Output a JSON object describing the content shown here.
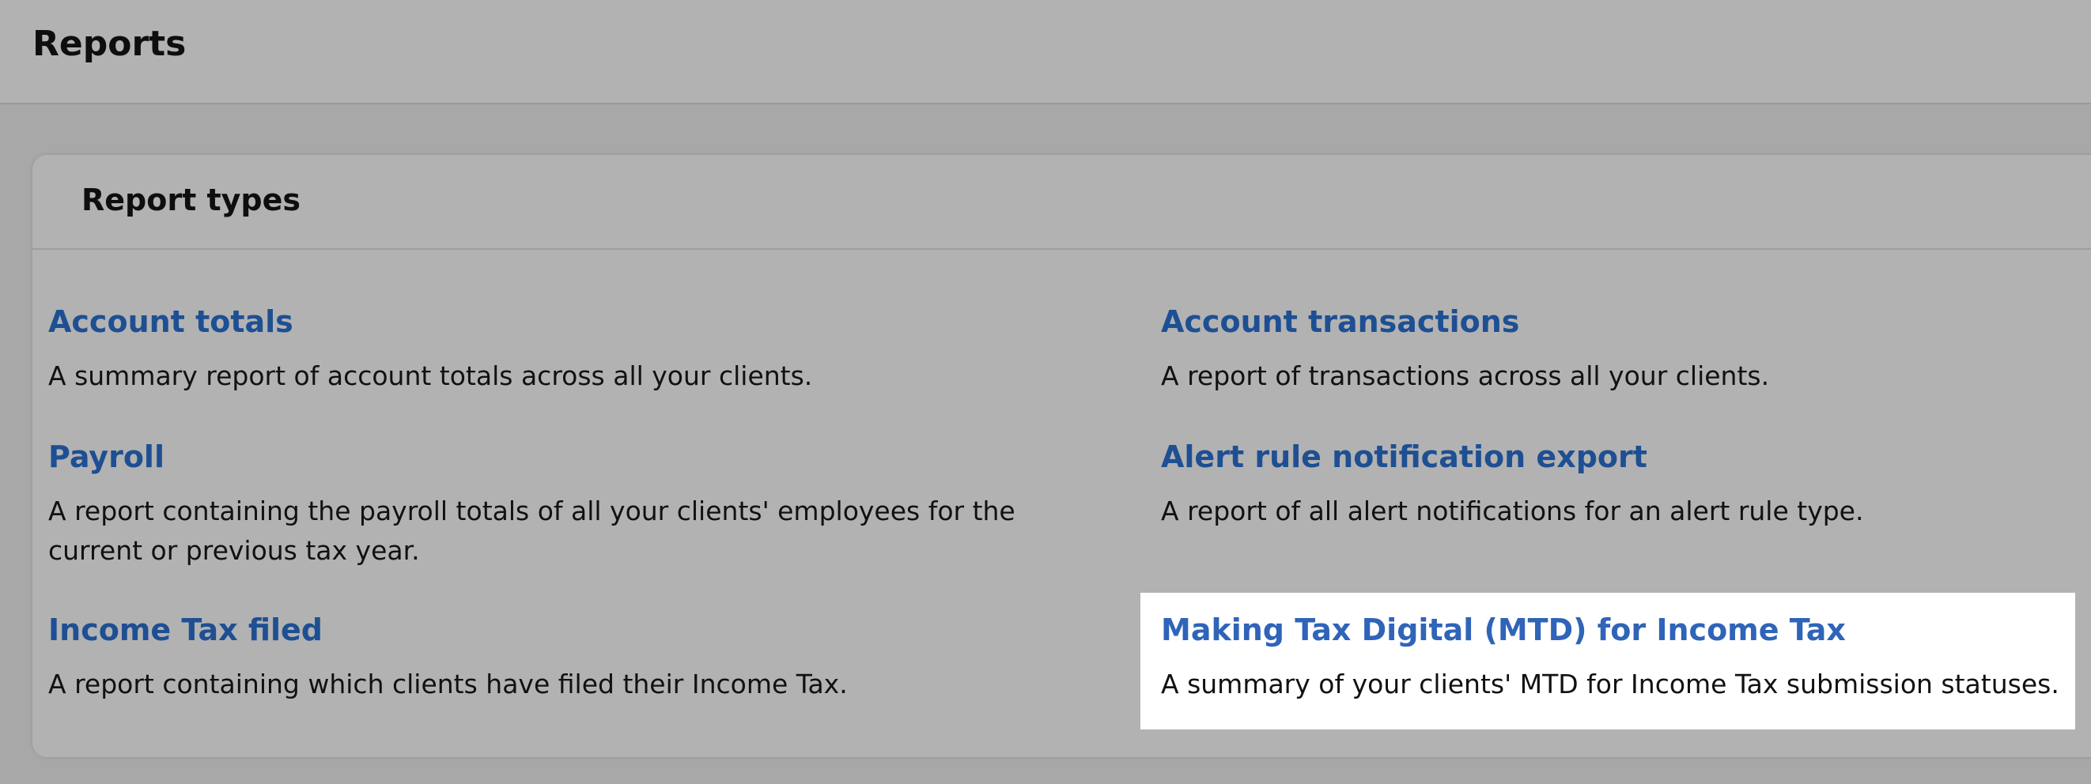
{
  "page": {
    "title": "Reports"
  },
  "card": {
    "title": "Report types"
  },
  "reports": [
    {
      "title": "Account totals",
      "description": "A summary report of account totals across all your clients."
    },
    {
      "title": "Account transactions",
      "description": "A report of transactions across all your clients."
    },
    {
      "title": "Payroll",
      "description": "A report containing the payroll totals of all your clients' employees for the current or previous tax year."
    },
    {
      "title": "Alert rule notification export",
      "description": "A report of all alert notifications for an alert rule type."
    },
    {
      "title": "Income Tax filed",
      "description": "A report containing which clients have filed their Income Tax."
    },
    {
      "title": "Making Tax Digital (MTD) for Income Tax",
      "description": "A summary of your clients' MTD for Income Tax submission statuses."
    }
  ],
  "colors": {
    "link": "#1e4f93",
    "link_highlighted": "#2f64b8",
    "overlay": "#a8a8a8",
    "highlight_bg": "#ffffff"
  }
}
